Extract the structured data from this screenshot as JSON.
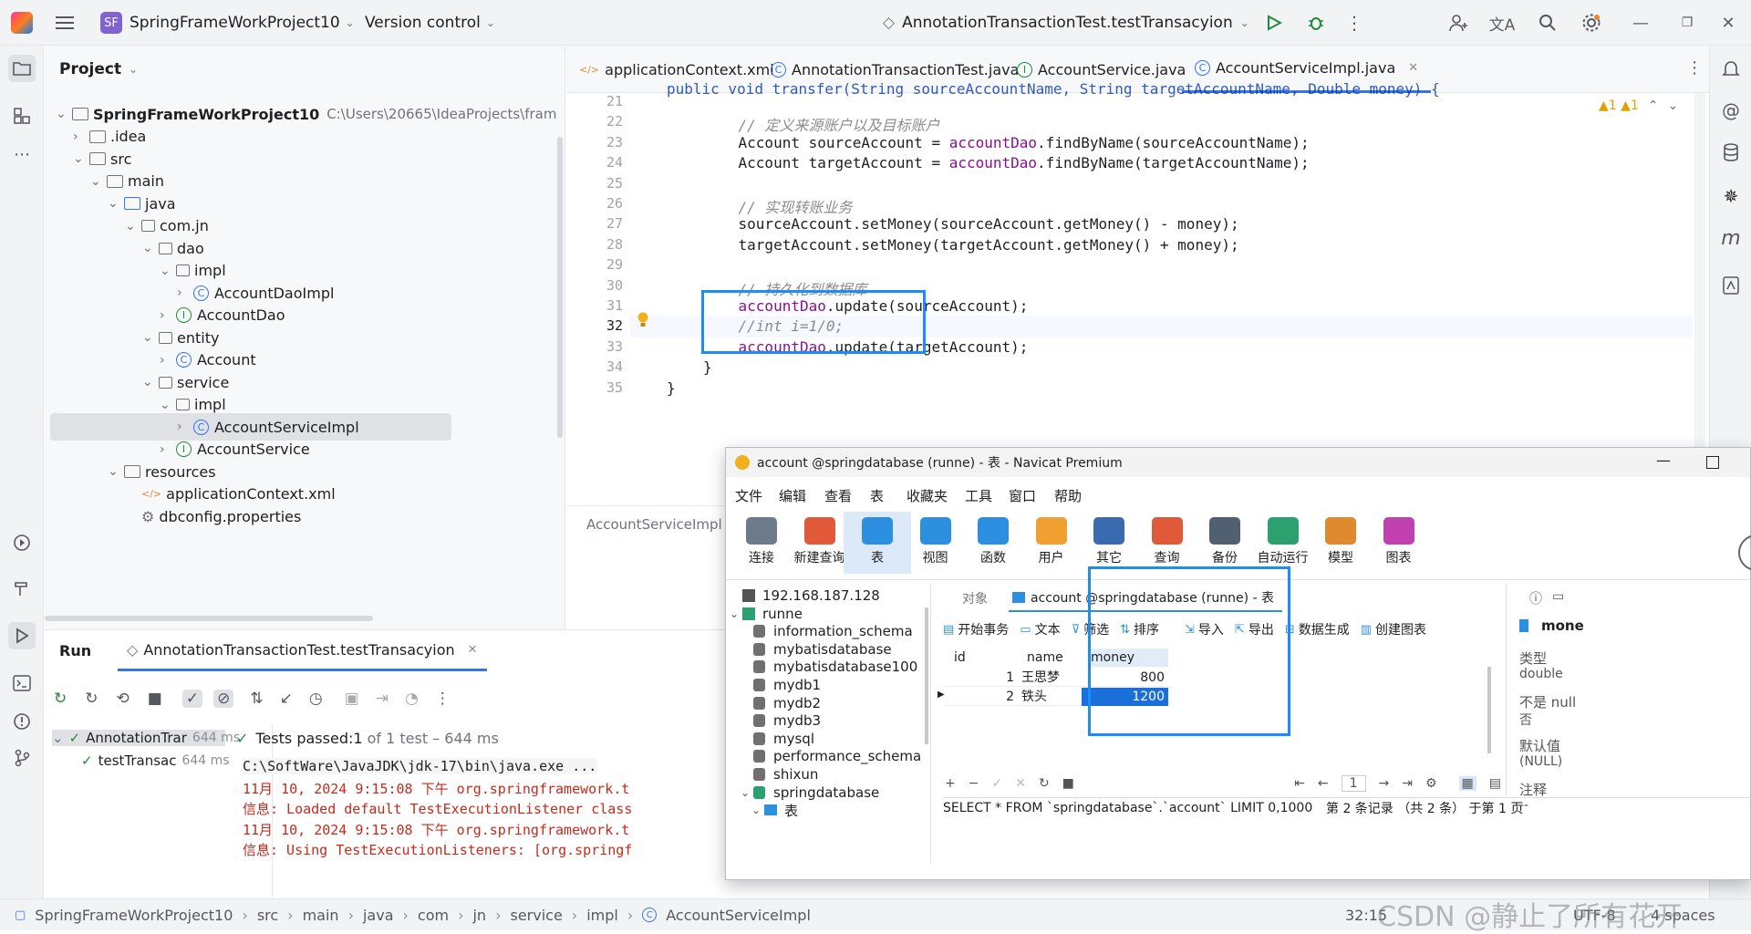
{
  "titlebar": {
    "project_badge": "SF",
    "project_name": "SpringFrameWorkProject10",
    "version_control": "Version control",
    "run_config": "AnnotationTransactionTest.testTransacyion"
  },
  "project_panel": {
    "title": "Project",
    "tree": [
      {
        "label": "SpringFrameWorkProject10",
        "extra": "C:\\Users\\20665\\IdeaProjects\\fram",
        "depth": 0,
        "kind": "folder",
        "open": true
      },
      {
        "label": ".idea",
        "depth": 1,
        "kind": "folder",
        "open": false
      },
      {
        "label": "src",
        "depth": 1,
        "kind": "folder",
        "open": true
      },
      {
        "label": "main",
        "depth": 2,
        "kind": "folder",
        "open": true
      },
      {
        "label": "java",
        "depth": 3,
        "kind": "folder",
        "open": true
      },
      {
        "label": "com.jn",
        "depth": 4,
        "kind": "package",
        "open": true
      },
      {
        "label": "dao",
        "depth": 5,
        "kind": "package",
        "open": true
      },
      {
        "label": "impl",
        "depth": 6,
        "kind": "package",
        "open": true
      },
      {
        "label": "AccountDaoImpl",
        "depth": 7,
        "kind": "class",
        "open": false
      },
      {
        "label": "AccountDao",
        "depth": 6,
        "kind": "interface",
        "open": false
      },
      {
        "label": "entity",
        "depth": 5,
        "kind": "package",
        "open": true
      },
      {
        "label": "Account",
        "depth": 6,
        "kind": "class",
        "open": false
      },
      {
        "label": "service",
        "depth": 5,
        "kind": "package",
        "open": true
      },
      {
        "label": "impl",
        "depth": 6,
        "kind": "package",
        "open": true
      },
      {
        "label": "AccountServiceImpl",
        "depth": 7,
        "kind": "class",
        "open": false,
        "selected": true
      },
      {
        "label": "AccountService",
        "depth": 6,
        "kind": "interface",
        "open": false
      },
      {
        "label": "resources",
        "depth": 3,
        "kind": "folder",
        "open": true
      },
      {
        "label": "applicationContext.xml",
        "depth": 4,
        "kind": "xml",
        "leaf": true
      },
      {
        "label": "dbconfig.properties",
        "depth": 4,
        "kind": "props",
        "leaf": true
      }
    ]
  },
  "editor": {
    "tabs": [
      {
        "label": "applicationContext.xml",
        "kind": "xml"
      },
      {
        "label": "AnnotationTransactionTest.java",
        "kind": "class"
      },
      {
        "label": "AccountService.java",
        "kind": "interface"
      },
      {
        "label": "AccountServiceImpl.java",
        "kind": "class",
        "active": true
      }
    ],
    "warnings": "▲1  ▲1",
    "breadcrumb": "AccountServiceImpl",
    "lines": [
      {
        "n": "21",
        "parts": []
      },
      {
        "n": "22",
        "parts": [
          {
            "t": "    // 定义来源账户以及目标账户",
            "c": "cm"
          }
        ]
      },
      {
        "n": "23",
        "parts": [
          {
            "t": "    Account sourceAccount = ",
            "c": ""
          },
          {
            "t": "accountDao",
            "c": "fld"
          },
          {
            "t": ".findByName(sourceAccountName);",
            "c": ""
          }
        ]
      },
      {
        "n": "24",
        "parts": [
          {
            "t": "    Account targetAccount = ",
            "c": ""
          },
          {
            "t": "accountDao",
            "c": "fld"
          },
          {
            "t": ".findByName(targetAccountName);",
            "c": ""
          }
        ]
      },
      {
        "n": "25",
        "parts": []
      },
      {
        "n": "26",
        "parts": [
          {
            "t": "    // 实现转账业务",
            "c": "cm"
          }
        ]
      },
      {
        "n": "27",
        "parts": [
          {
            "t": "    sourceAccount.setMoney(sourceAccount.getMoney() - money);",
            "c": ""
          }
        ]
      },
      {
        "n": "28",
        "parts": [
          {
            "t": "    targetAccount.setMoney(targetAccount.getMoney() + money);",
            "c": ""
          }
        ]
      },
      {
        "n": "29",
        "parts": []
      },
      {
        "n": "30",
        "parts": [
          {
            "t": "    // 持久化到数据库",
            "c": "cm"
          }
        ]
      },
      {
        "n": "31",
        "parts": [
          {
            "t": "    ",
            "c": ""
          },
          {
            "t": "accountDao",
            "c": "fld"
          },
          {
            "t": ".update(sourceAccount);",
            "c": ""
          }
        ]
      },
      {
        "n": "32",
        "parts": [
          {
            "t": "    //int i=1/0;",
            "c": "cm"
          }
        ]
      },
      {
        "n": "33",
        "parts": [
          {
            "t": "    ",
            "c": ""
          },
          {
            "t": "accountDao",
            "c": "fld"
          },
          {
            "t": ".update(targetAccount);",
            "c": ""
          }
        ]
      },
      {
        "n": "34",
        "parts": [
          {
            "t": "}",
            "c": ""
          }
        ]
      },
      {
        "n": "35",
        "parts": [
          {
            "t": "}",
            "c": ""
          }
        ]
      }
    ]
  },
  "run": {
    "tab_label": "Run",
    "config_tab": "AnnotationTransactionTest.testTransacyion",
    "tests": [
      {
        "name": "AnnotationTrar",
        "time": "644 ms"
      },
      {
        "name": "testTransac",
        "time": "644 ms"
      }
    ],
    "summary_prefix": "Tests passed: ",
    "summary_count": "1",
    "summary_suffix": " of 1 test – 644 ms",
    "console": [
      {
        "text": "C:\\SoftWare\\JavaJDK\\jdk-17\\bin\\java.exe ...",
        "c": "#1e1f22"
      },
      {
        "text": "11月 10, 2024 9:15:08 下午 org.springframework.t",
        "c": "#c42b1c"
      },
      {
        "text": "信息: Loaded default TestExecutionListener class",
        "c": "#c42b1c"
      },
      {
        "text": "11月 10, 2024 9:15:08 下午 org.springframework.t",
        "c": "#c42b1c"
      },
      {
        "text": "信息: Using TestExecutionListeners: [org.springf",
        "c": "#c42b1c"
      }
    ]
  },
  "statusbar": {
    "crumbs": [
      "SpringFrameWorkProject10",
      "src",
      "main",
      "java",
      "com",
      "jn",
      "service",
      "impl",
      "AccountServiceImpl"
    ],
    "position": "32:15",
    "encoding": "UTF-8",
    "indent": "4 spaces",
    "watermark": "CSDN @静止了所有花开"
  },
  "navicat": {
    "title": "account @springdatabase (runne) - 表 - Navicat Premium",
    "menus": [
      "文件",
      "编辑",
      "查看",
      "表",
      "收藏夹",
      "工具",
      "窗口",
      "帮助"
    ],
    "tools": [
      {
        "label": "连接",
        "color": "#6c7a89"
      },
      {
        "label": "新建查询",
        "color": "#e05a3a"
      },
      {
        "label": "表",
        "color": "#2d8fe0"
      },
      {
        "label": "视图",
        "color": "#2d8fe0"
      },
      {
        "label": "函数",
        "color": "#2d8fe0"
      },
      {
        "label": "用户",
        "color": "#f0a030"
      },
      {
        "label": "其它",
        "color": "#3a6ab0"
      },
      {
        "label": "查询",
        "color": "#e05a3a"
      },
      {
        "label": "备份",
        "color": "#506070"
      },
      {
        "label": "自动运行",
        "color": "#2da070"
      },
      {
        "label": "模型",
        "color": "#e08a30"
      },
      {
        "label": "图表",
        "color": "#c040b0"
      }
    ],
    "connections": [
      {
        "label": "192.168.187.128",
        "depth": 0,
        "kind": "conn"
      },
      {
        "label": "runne",
        "depth": 0,
        "kind": "conn-open"
      },
      {
        "label": "information_schema",
        "depth": 1,
        "kind": "db"
      },
      {
        "label": "mybatisdatabase",
        "depth": 1,
        "kind": "db"
      },
      {
        "label": "mybatisdatabase100",
        "depth": 1,
        "kind": "db"
      },
      {
        "label": "mydb1",
        "depth": 1,
        "kind": "db"
      },
      {
        "label": "mydb2",
        "depth": 1,
        "kind": "db"
      },
      {
        "label": "mydb3",
        "depth": 1,
        "kind": "db"
      },
      {
        "label": "mysql",
        "depth": 1,
        "kind": "db"
      },
      {
        "label": "performance_schema",
        "depth": 1,
        "kind": "db"
      },
      {
        "label": "shixun",
        "depth": 1,
        "kind": "db"
      },
      {
        "label": "springdatabase",
        "depth": 1,
        "kind": "db-open"
      },
      {
        "label": "表",
        "depth": 2,
        "kind": "tables"
      }
    ],
    "obj_tab": "对象",
    "table_tab": "account @springdatabase (runne) - 表",
    "actions": [
      "开始事务",
      "文本",
      "筛选",
      "排序",
      "导入",
      "导出",
      "数据生成",
      "创建图表"
    ],
    "columns": [
      "id",
      "name",
      "money"
    ],
    "rows": [
      {
        "id": "1",
        "name": "王思梦",
        "money": "800"
      },
      {
        "id": "2",
        "name": "铁头",
        "money": "1200"
      }
    ],
    "page": "1",
    "sql": "SELECT * FROM `springdatabase`.`account` LIMIT 0,1000",
    "record_info": "第 2 条记录 （共 2 条） 于第 1 页",
    "side_field": "mone",
    "side_props": [
      {
        "k": "类型",
        "v": "double"
      },
      {
        "k": "不是 null",
        "v": "否"
      },
      {
        "k": "默认值",
        "v": "(NULL)"
      },
      {
        "k": "注释",
        "v": "--"
      }
    ]
  }
}
